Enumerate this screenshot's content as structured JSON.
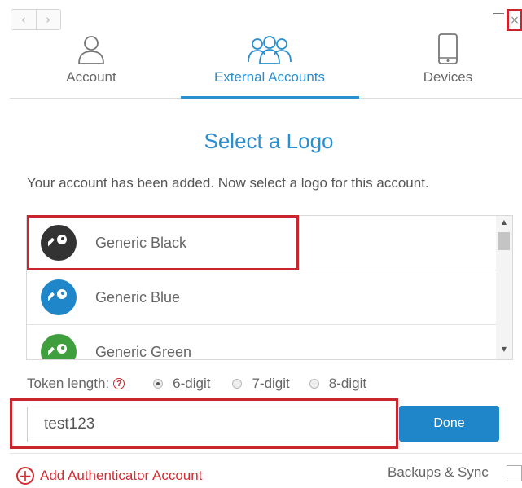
{
  "window": {
    "close_label": "×"
  },
  "tabs": [
    {
      "label": "Account",
      "icon": "person-icon",
      "active": false
    },
    {
      "label": "External Accounts",
      "icon": "group-icon",
      "active": true
    },
    {
      "label": "Devices",
      "icon": "phone-icon",
      "active": false
    }
  ],
  "title": "Select a Logo",
  "subtitle": "Your account has been added. Now select a logo for this account.",
  "logos": [
    {
      "name": "Generic Black",
      "color": "#333333"
    },
    {
      "name": "Generic Blue",
      "color": "#1f86c9"
    },
    {
      "name": "Generic Green",
      "color": "#3f9f3f"
    }
  ],
  "token": {
    "label": "Token length:",
    "options": [
      "6-digit",
      "7-digit",
      "8-digit"
    ],
    "selected": "6-digit"
  },
  "input": {
    "value": "test123"
  },
  "done_label": "Done",
  "add_account_label": "Add Authenticator Account",
  "backups_label": "Backups & Sync",
  "colors": {
    "accent": "#2a8fce",
    "highlight": "#c8252c",
    "button": "#1f86c9"
  }
}
